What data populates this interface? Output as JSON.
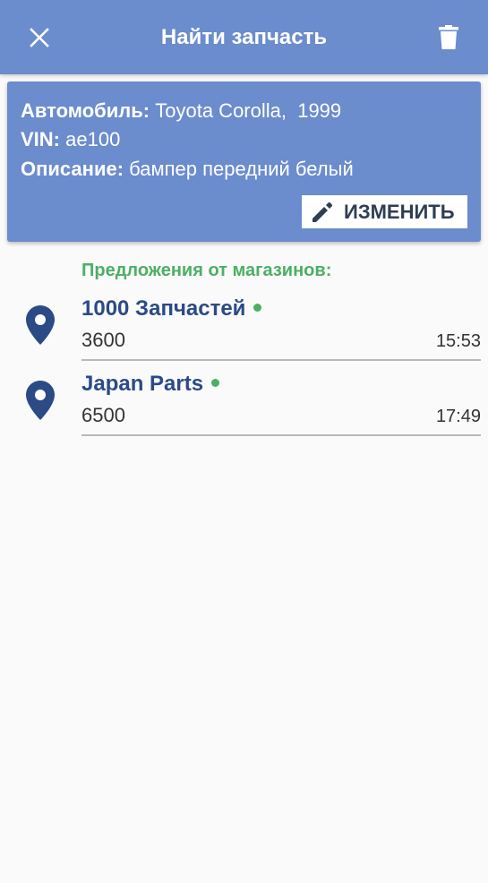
{
  "appbar": {
    "title": "Найти запчасть",
    "close_icon": "close-icon",
    "delete_icon": "trash-icon",
    "background": "#6b8ccd"
  },
  "request": {
    "car_label": "Автомобиль:",
    "car_value": "Toyota Corolla,  1999",
    "vin_label": "VIN:",
    "vin_value": "ae100",
    "description_label": "Описание:",
    "description_value": "бампер передний белый",
    "edit_label": "ИЗМЕНИТЬ",
    "edit_icon": "pencil-icon"
  },
  "offers": {
    "heading": "Предложения от магазинов:",
    "accent": "#4caf65",
    "items": [
      {
        "shop": "1000 Запчастей",
        "price": "3600",
        "time": "15:53",
        "online": true,
        "icon": "location-pin-icon"
      },
      {
        "shop": "Japan Parts",
        "price": "6500",
        "time": "17:49",
        "online": true,
        "icon": "location-pin-icon"
      }
    ]
  }
}
